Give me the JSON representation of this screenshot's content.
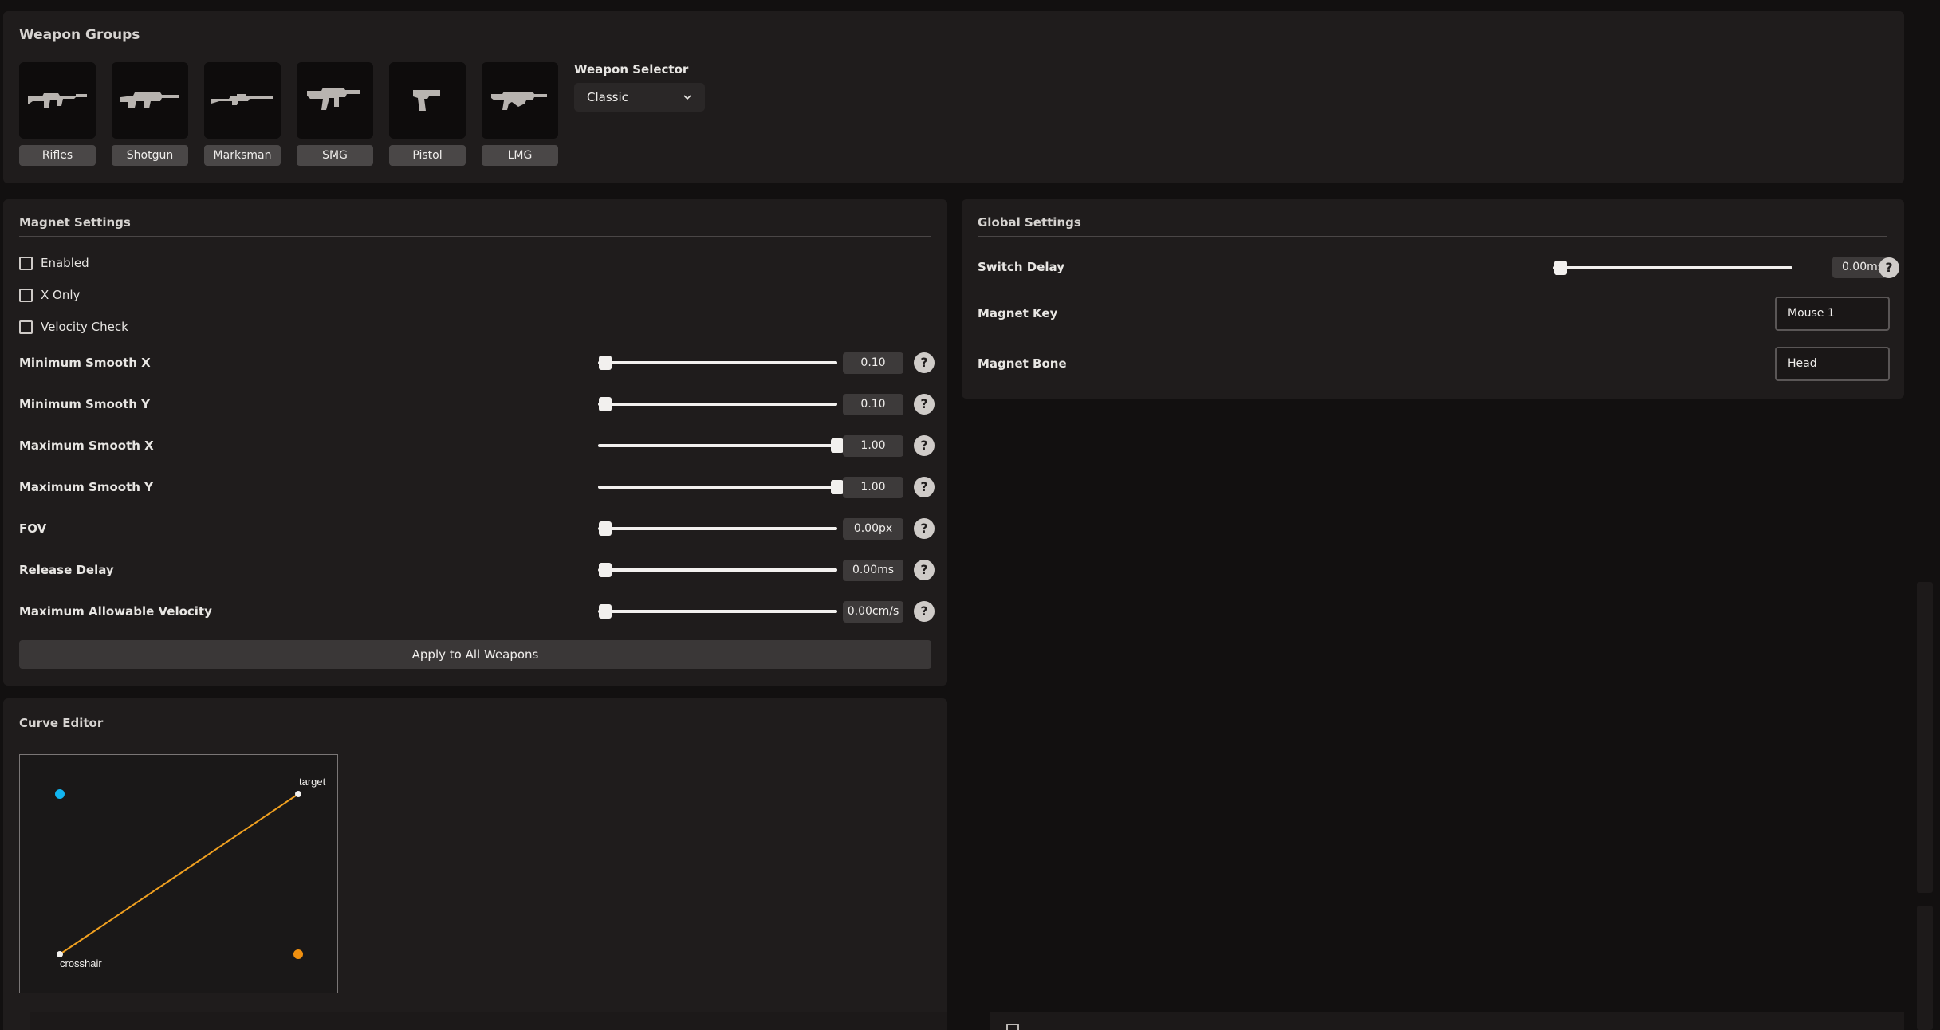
{
  "weapon_groups": {
    "title": "Weapon Groups",
    "items": [
      {
        "label": "Rifles",
        "icon": "rifle-icon"
      },
      {
        "label": "Shotgun",
        "icon": "shotgun-icon"
      },
      {
        "label": "Marksman",
        "icon": "marksman-icon"
      },
      {
        "label": "SMG",
        "icon": "smg-icon"
      },
      {
        "label": "Pistol",
        "icon": "pistol-icon"
      },
      {
        "label": "LMG",
        "icon": "lmg-icon"
      }
    ],
    "selector_label": "Weapon Selector",
    "selector_value": "Classic"
  },
  "magnet": {
    "title": "Magnet Settings",
    "checks": [
      {
        "label": "Enabled",
        "checked": false
      },
      {
        "label": "X Only",
        "checked": false
      },
      {
        "label": "Velocity Check",
        "checked": false
      }
    ],
    "sliders": [
      {
        "label": "Minimum Smooth X",
        "value": "0.10",
        "level": 0.03
      },
      {
        "label": "Minimum Smooth Y",
        "value": "0.10",
        "level": 0.03
      },
      {
        "label": "Maximum Smooth X",
        "value": "1.00",
        "level": 1.0
      },
      {
        "label": "Maximum Smooth Y",
        "value": "1.00",
        "level": 1.0
      },
      {
        "label": "FOV",
        "value": "0.00px",
        "level": 0.03
      },
      {
        "label": "Release Delay",
        "value": "0.00ms",
        "level": 0.03
      },
      {
        "label": "Maximum Allowable Velocity",
        "value": "0.00cm/s",
        "level": 0.03
      }
    ],
    "apply_label": "Apply to All Weapons"
  },
  "global": {
    "title": "Global Settings",
    "switch_delay_label": "Switch Delay",
    "switch_delay_value": "0.00ms",
    "switch_delay_level": 0.03,
    "magnet_key_label": "Magnet Key",
    "magnet_key_value": "Mouse 1",
    "magnet_bone_label": "Magnet Bone",
    "magnet_bone_value": "Head"
  },
  "curve": {
    "title": "Curve Editor",
    "target_label": "target",
    "crosshair_label": "crosshair",
    "line_color": "#f0a020",
    "control1_color": "#12b5f0",
    "control2_color": "#f09010"
  },
  "help_glyph": "?",
  "colors": {
    "background": "#121010",
    "panel": "#1f1c1c",
    "accent_blue": "#12b5f0",
    "accent_orange": "#f0a020"
  }
}
